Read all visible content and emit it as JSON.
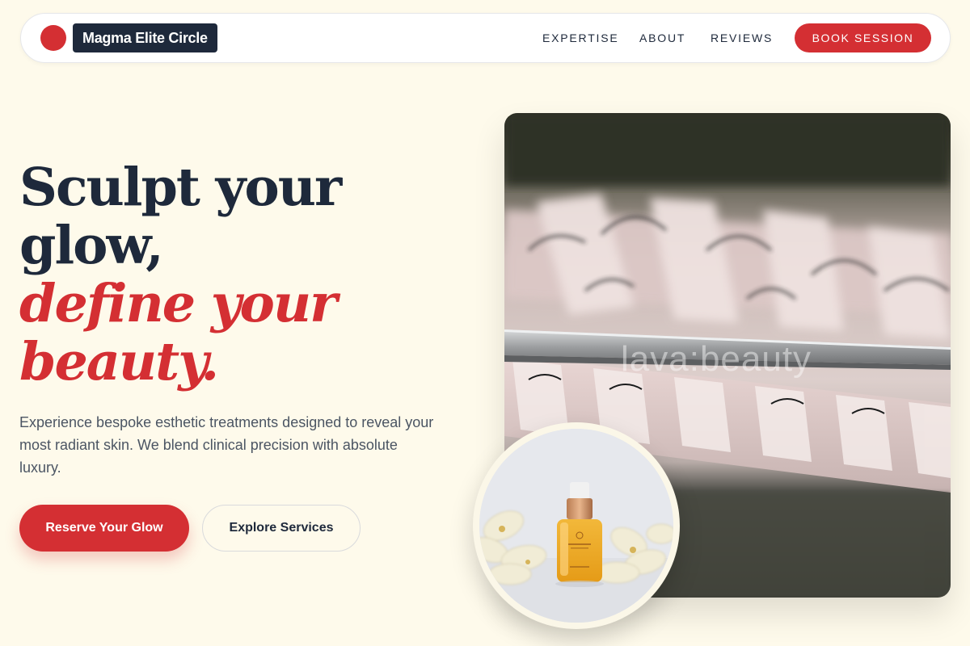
{
  "header": {
    "brand_name": "Magma Elite Circle",
    "nav": [
      "EXPERTISE",
      "ABOUT",
      "REVIEWS"
    ],
    "book_label": "BOOK SESSION"
  },
  "hero": {
    "headline_line1": "Sculpt your",
    "headline_line2": "glow,",
    "headline_line3": "define your",
    "headline_line4": "beauty.",
    "lead": "Experience bespoke esthetic treatments designed to reveal your most radiant skin. We blend clinical precision with absolute luxury.",
    "primary_cta": "Reserve Your Glow",
    "secondary_cta": "Explore Services"
  },
  "media": {
    "main_photo": "eyelash-extension-tray-with-tweezers",
    "watermark": "lava:beauty",
    "inset_photo": "serum-bottle-with-white-flowers"
  },
  "colors": {
    "background": "#fefaeb",
    "accent": "#d42f33",
    "navy": "#1e293b",
    "body_text": "#4b5563"
  }
}
